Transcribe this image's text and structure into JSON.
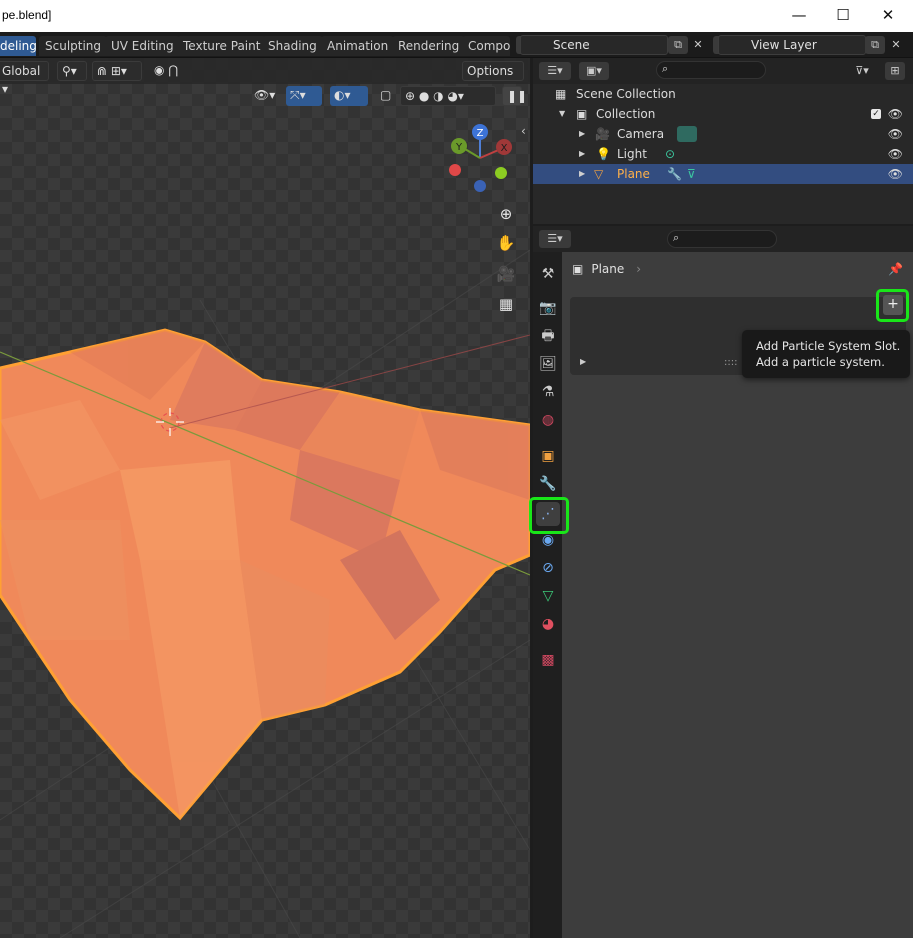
{
  "window": {
    "title": "pe.blend]",
    "minimize": "—",
    "maximize": "☐",
    "close": "✕"
  },
  "workspace_tabs": [
    "deling",
    "Sculpting",
    "UV Editing",
    "Texture Paint",
    "Shading",
    "Animation",
    "Rendering",
    "Compos"
  ],
  "active_workspace": "deling",
  "scene": {
    "name": "Scene",
    "view_layer": "View Layer"
  },
  "viewport": {
    "orientation": "Global",
    "options_label": "Options",
    "gizmo_axes": {
      "z": "Z",
      "y": "Y",
      "x": "X"
    }
  },
  "outliner": {
    "rows": [
      {
        "label": "Scene Collection"
      },
      {
        "label": "Collection"
      },
      {
        "label": "Camera"
      },
      {
        "label": "Light"
      },
      {
        "label": "Plane",
        "selected": true
      }
    ]
  },
  "properties": {
    "object_name": "Plane",
    "plus_label": "+",
    "panel_dots": "::::",
    "tooltip": {
      "line1": "Add Particle System Slot.",
      "line2": "Add a particle system."
    }
  },
  "colors": {
    "accent_blue": "#2f5a93",
    "highlight_green": "#19e619",
    "mesh_orange": "#f0895a",
    "selected_orange": "#ffa033"
  }
}
